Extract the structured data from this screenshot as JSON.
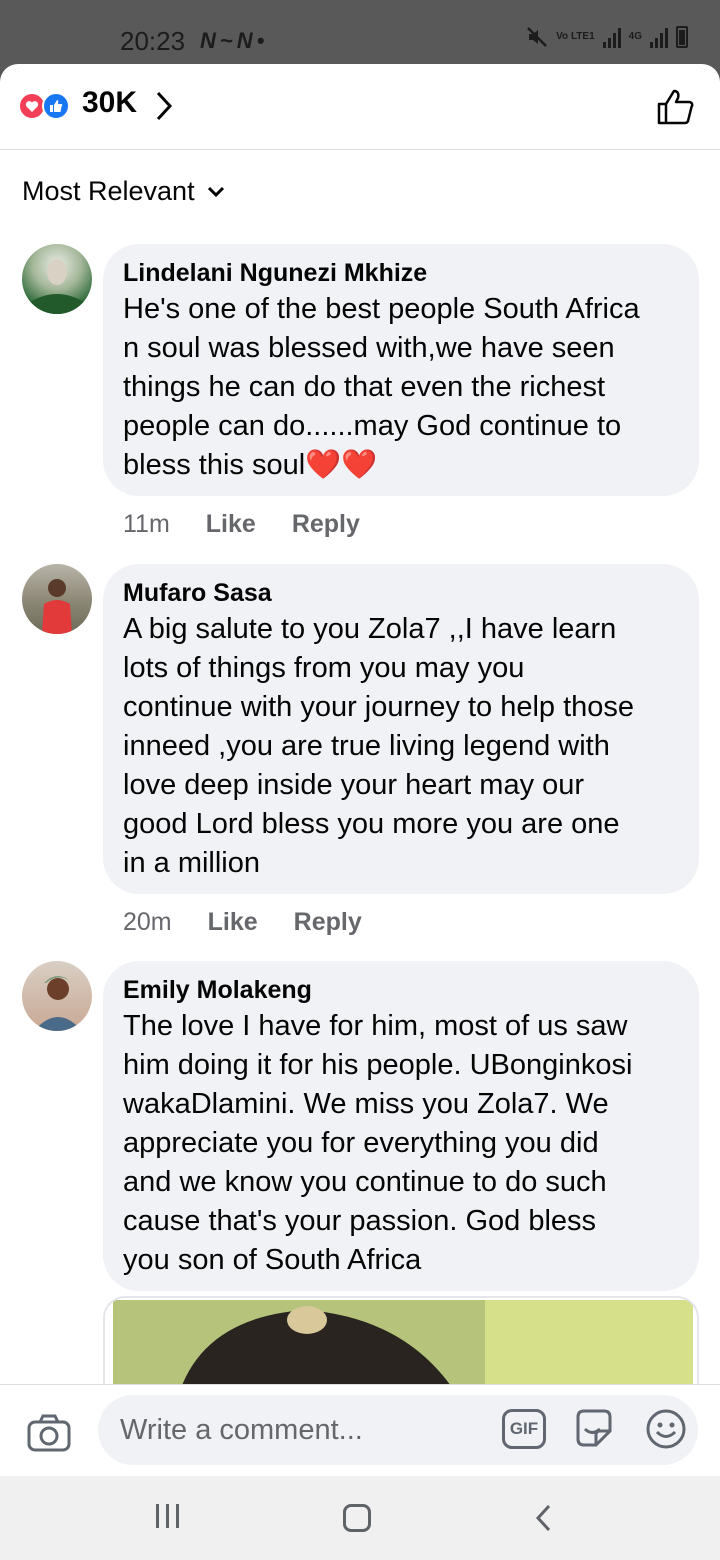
{
  "status_bar": {
    "time": "20:23",
    "notif_icons": [
      "N",
      "N"
    ],
    "network_label": "Vo LTE1",
    "network_type": "4G"
  },
  "reactions": {
    "count": "30K",
    "icons": [
      "heart-reaction-icon",
      "like-reaction-icon"
    ],
    "heart_color": "#f33e58",
    "like_color": "#1877f2"
  },
  "sort": {
    "label": "Most Relevant"
  },
  "comments": [
    {
      "author": "Lindelani Ngunezi Mkhize",
      "text": "He's one of the best people South Africa\nn soul was blessed with,we have seen\nthings he can do that even the richest\npeople can do......may God continue to\nbless this soul❤️❤️",
      "time": "11m",
      "like": "Like",
      "reply": "Reply"
    },
    {
      "author": "Mufaro Sasa",
      "text": "A big salute to you Zola7 ,,I have learn\nlots of things from you may you\ncontinue with your journey to help those\ninneed  ,you are true living legend with\nlove deep inside your heart may our\ngood Lord bless you more you are one\nin a million",
      "time": "20m",
      "like": "Like",
      "reply": "Reply"
    },
    {
      "author": "Emily Molakeng",
      "text": "The love I have for him, most of us saw\nhim doing it for his people. UBonginkosi\nwakaDlamini. We miss you Zola7. We\nappreciate you for everything you did\nand we know you continue to do such\ncause that's your passion. God bless\nyou son of South Africa"
    }
  ],
  "composer": {
    "placeholder": "Write a comment...",
    "gif_label": "GIF"
  },
  "colors": {
    "bubble_bg": "#f0f2f5",
    "secondary_text": "#65676b",
    "accent": "#1877f2"
  }
}
